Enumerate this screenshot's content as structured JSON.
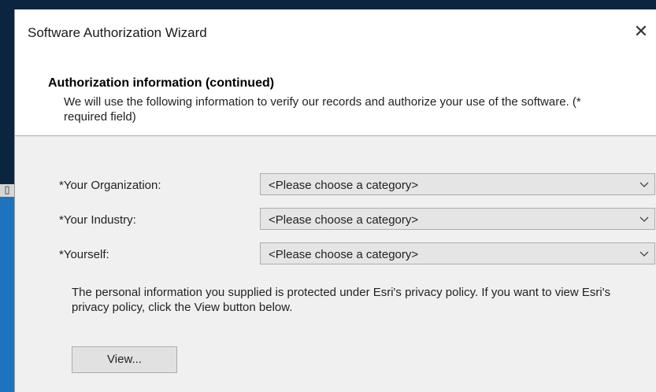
{
  "window": {
    "title": "Software Authorization Wizard",
    "close_glyph": "✕"
  },
  "header": {
    "title": "Authorization information (continued)",
    "description": "We will use the following information to verify our records and authorize your use of the software. (* required field)"
  },
  "form": {
    "fields": [
      {
        "label": "*Your Organization:",
        "value": "<Please choose a category>"
      },
      {
        "label": "*Your Industry:",
        "value": "<Please choose a category>"
      },
      {
        "label": "*Yourself:",
        "value": "<Please choose a category>"
      }
    ]
  },
  "privacy": {
    "text": "The personal information you supplied is protected under Esri's privacy policy. If you want to view Esri's privacy policy, click the View button below."
  },
  "buttons": {
    "view_label": "View..."
  },
  "icons": {
    "close": "close-icon",
    "dropdown": "chevron-down-icon"
  },
  "colors": {
    "backdrop": "#0b2440",
    "window_bg": "#f0f0f0",
    "combo_bg": "#e5e5e5"
  }
}
